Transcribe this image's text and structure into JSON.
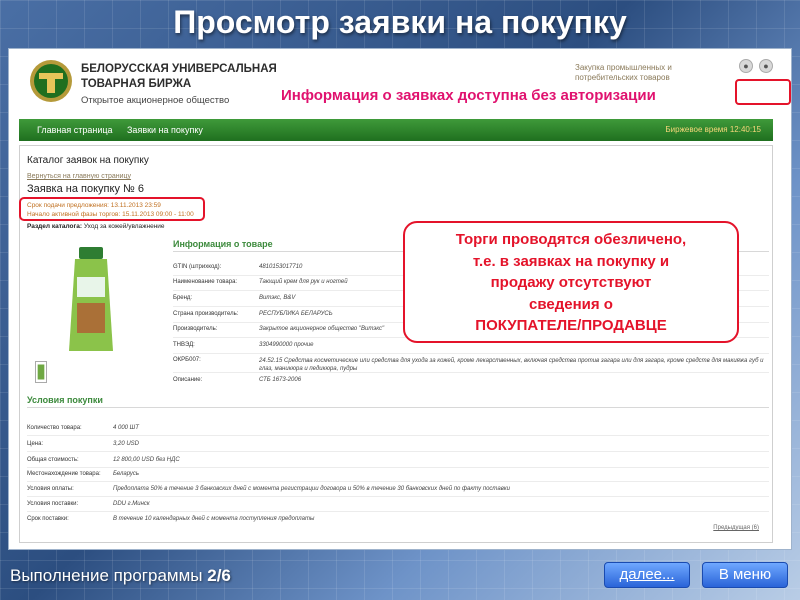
{
  "slide": {
    "title": "Просмотр заявки на покупку",
    "footer_text": "Выполнение программы",
    "footer_step": "2/6",
    "next_label": "далее...",
    "menu_label": "В меню"
  },
  "header": {
    "org_line1": "БЕЛОРУССКАЯ УНИВЕРСАЛЬНАЯ",
    "org_line2": "ТОВАРНАЯ БИРЖА",
    "org_line3": "Открытое акционерное общество",
    "link_line1": "Закупка промышленных и",
    "link_line2": "потребительских товаров"
  },
  "annotation": {
    "auth_note": "Информация о заявках доступна без авторизации",
    "callout_lines": [
      "Торги проводятся обезличено,",
      "т.е. в заявках на покупку и",
      "продажу отсутствуют",
      "сведения о",
      "ПОКУПАТЕЛЕ/ПРОДАВЦЕ"
    ]
  },
  "nav": {
    "items": [
      "Главная страница",
      "Заявки на покупку"
    ],
    "time": "Биржевое время 12:40:15"
  },
  "page": {
    "catalog_title": "Каталог заявок на покупку",
    "back_link": "Вернуться на главную страницу",
    "order_title": "Заявка на покупку № 6",
    "date_submission": "Срок подачи предложения: 13.11.2013 23:59",
    "date_active": "Начало активной фазы торгов: 15.11.2013 09:00 - 11:00",
    "section_label_key": "Раздел каталога:",
    "section_label_value": "Уход за кожей/увлажнение",
    "info_heading": "Информация о товаре",
    "conditions_heading": "Условия покупки",
    "prev_link": "Предыдущая (6)"
  },
  "product_info": [
    {
      "label": "GTIN (штрихкод):",
      "value": "4810153017710"
    },
    {
      "label": "Наименование товара:",
      "value": "Тающий крем для рук и ногтей"
    },
    {
      "label": "Бренд:",
      "value": "Витэкс, B&V"
    },
    {
      "label": "Страна производитель:",
      "value": "РЕСПУБЛИКА БЕЛАРУСЬ"
    },
    {
      "label": "Производитель:",
      "value": "Закрытое акционерное общество \"Витэкс\""
    },
    {
      "label": "ТНВЭД:",
      "value": "3304990000 прочие"
    },
    {
      "label": "ОКРБ007:",
      "value": "24.52.15 Средства косметические или средства для ухода за кожей, кроме лекарственных, включая средства против загара или для загара, кроме средств для макияжа губ и глаз, маникюра и педикюра, пудры"
    },
    {
      "label": "Описание:",
      "value": "СТБ 1673-2006"
    }
  ],
  "conditions": [
    {
      "label": "Количество товара:",
      "value": "4 000 ШТ"
    },
    {
      "label": "Цена:",
      "value": "3,20 USD"
    },
    {
      "label": "Общая стоимость:",
      "value": "12 800,00 USD без НДС"
    },
    {
      "label": "Местонахождение товара:",
      "value": "Беларусь"
    },
    {
      "label": "Условия оплаты:",
      "value": "Предоплата 50% в течение 3 банковских дней с момента регистрации договора и 50% в течение 30 банковских дней по факту поставки"
    },
    {
      "label": "Условия поставки:",
      "value": "DDU г.Минск"
    },
    {
      "label": "Срок поставки:",
      "value": "В течение 10 календарных дней с момента поступления предоплаты"
    }
  ],
  "colors": {
    "accent_red": "#e4132a",
    "accent_pink": "#e0126f",
    "nav_green": "#2a7e2a",
    "heading_green": "#3c8a3c"
  }
}
